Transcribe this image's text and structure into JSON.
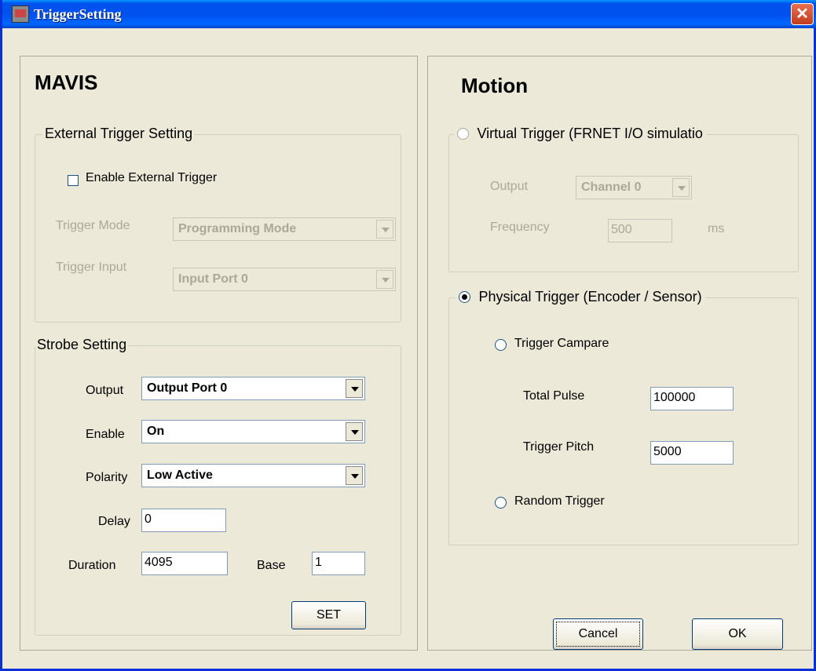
{
  "window": {
    "title": "TriggerSetting"
  },
  "mavis": {
    "heading": "MAVIS",
    "external": {
      "legend": "External Trigger Setting",
      "enable_label": "Enable External Trigger",
      "enable_checked": false,
      "mode_label": "Trigger Mode",
      "mode_value": "Programming Mode",
      "input_label": "Trigger Input",
      "input_value": "Input Port 0"
    },
    "strobe": {
      "legend": "Strobe Setting",
      "output_label": "Output",
      "output_value": "Output Port 0",
      "enable_label": "Enable",
      "enable_value": "On",
      "polarity_label": "Polarity",
      "polarity_value": "Low Active",
      "delay_label": "Delay",
      "delay_value": "0",
      "duration_label": "Duration",
      "duration_value": "4095",
      "base_label": "Base",
      "base_value": "1",
      "set_label": "SET"
    }
  },
  "motion": {
    "heading": "Motion",
    "virtual": {
      "legend": "Virtual Trigger (FRNET I/O simulatio",
      "selected": false,
      "output_label": "Output",
      "output_value": "Channel 0",
      "frequency_label": "Frequency",
      "frequency_value": "500",
      "unit": "ms"
    },
    "physical": {
      "legend": "Physical Trigger (Encoder / Sensor)",
      "selected": true,
      "compare_label": "Trigger Campare",
      "total_pulse_label": "Total Pulse",
      "total_pulse_value": "100000",
      "trigger_pitch_label": "Trigger Pitch",
      "trigger_pitch_value": "5000",
      "random_label": "Random Trigger"
    }
  },
  "buttons": {
    "cancel": "Cancel",
    "ok": "OK"
  }
}
